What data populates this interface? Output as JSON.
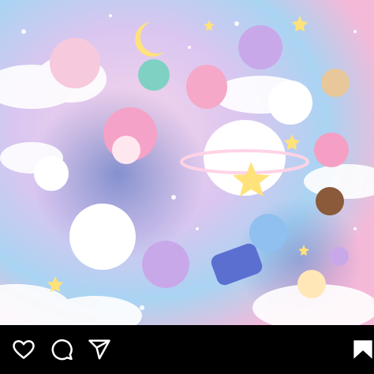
{
  "post": {
    "image": {
      "icon": "artwork-image",
      "palette": {
        "sky_pink": "#f5b9d8",
        "sky_blue": "#a9d4f2",
        "sky_lavender": "#d9c6f0",
        "cloud_white": "#ffffff",
        "deep_blue": "#2f5fb5",
        "star_yellow": "#ffe27a"
      }
    }
  },
  "action_bar": {
    "background": "#000000",
    "icon_color": "#ffffff",
    "like_icon": "heart-icon",
    "comment_icon": "comment-icon",
    "share_icon": "share-icon",
    "save_icon": "bookmark-icon"
  }
}
